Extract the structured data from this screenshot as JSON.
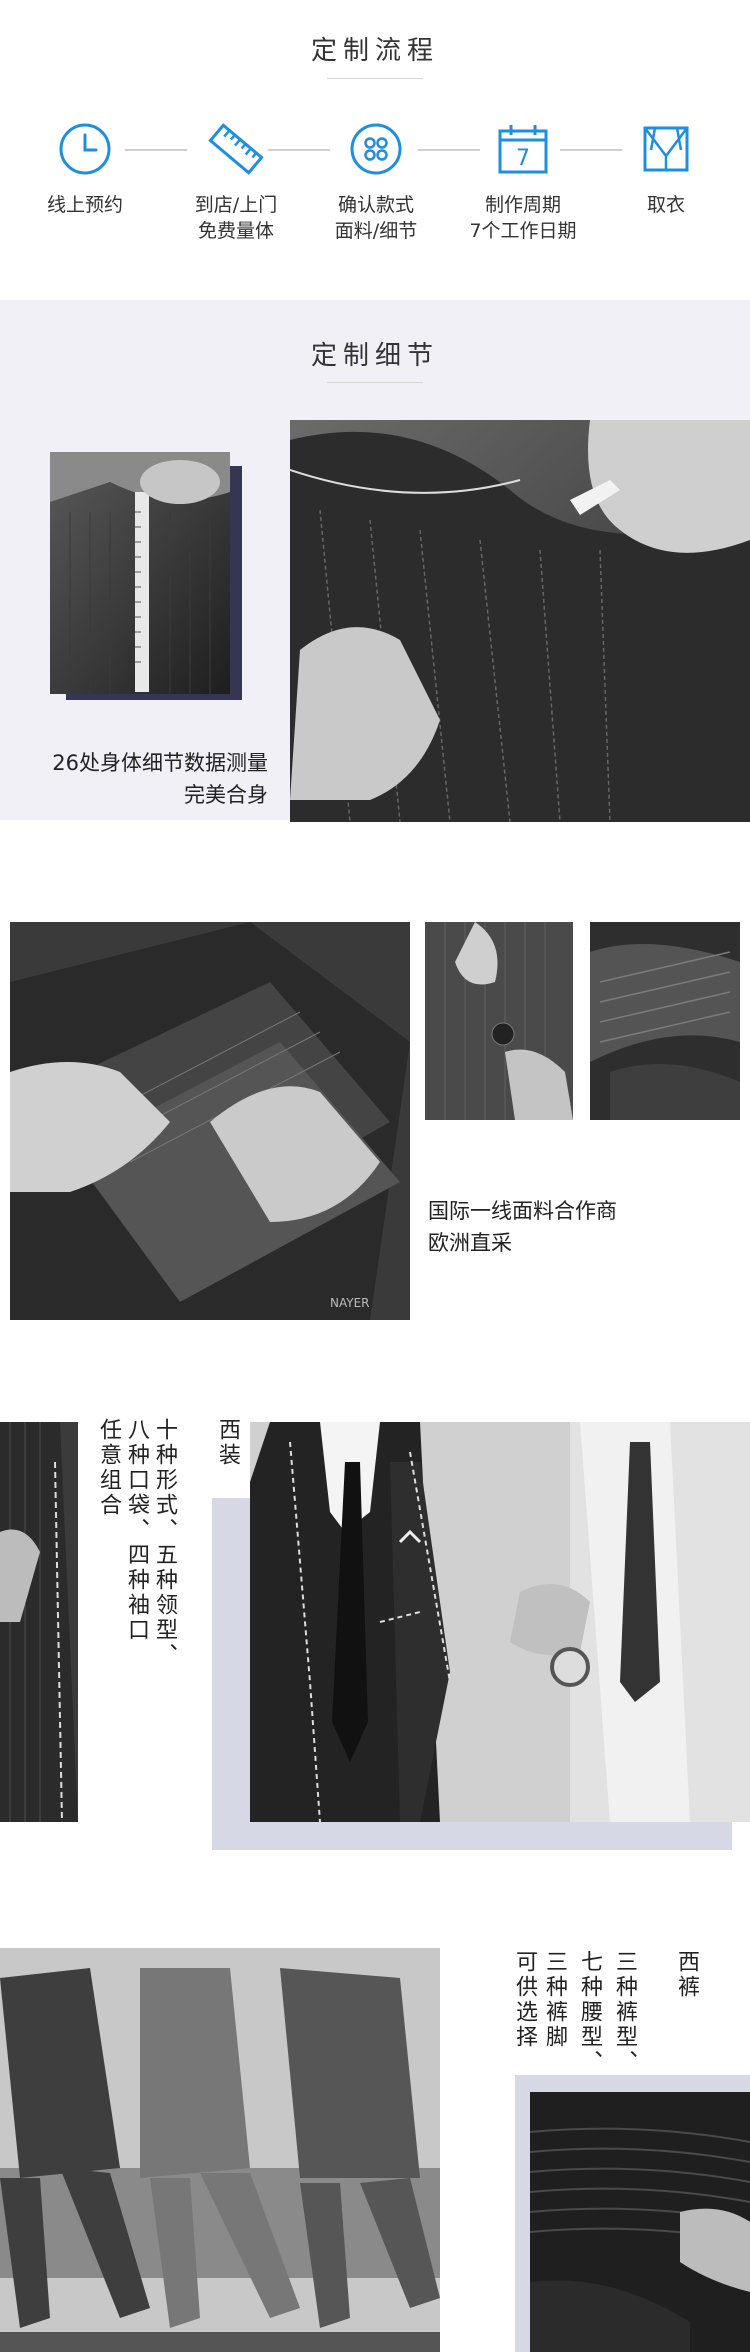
{
  "process": {
    "title": "定制流程",
    "steps": [
      {
        "icon": "clock-icon",
        "line1": "线上预约",
        "line2": ""
      },
      {
        "icon": "ruler-icon",
        "line1": "到店/上门",
        "line2": "免费量体"
      },
      {
        "icon": "button-icon",
        "line1": "确认款式",
        "line2": "面料/细节"
      },
      {
        "icon": "calendar-icon",
        "line1": "制作周期",
        "line2": "7个工作日期"
      },
      {
        "icon": "jacket-icon",
        "line1": "取衣",
        "line2": ""
      }
    ],
    "calendar_day": "7",
    "accent_color": "#1e8fe0"
  },
  "details": {
    "title": "定制细节",
    "measure_caption_1": "26处身体细节数据测量",
    "measure_caption_2": "完美合身",
    "fabric_caption_1": "国际一线面料合作商",
    "fabric_caption_2": "欧洲直采",
    "fabric_label": "NAYER"
  },
  "suit": {
    "heading": "西装",
    "line1": "十种形式、五种领型、",
    "line2": "八种口袋、四种袖口",
    "line3": "任意组合"
  },
  "trousers": {
    "heading": "西裤",
    "line1": "三种裤型、",
    "line2": "七种腰型、",
    "line3": "三种裤脚",
    "line4": "可供选择"
  }
}
